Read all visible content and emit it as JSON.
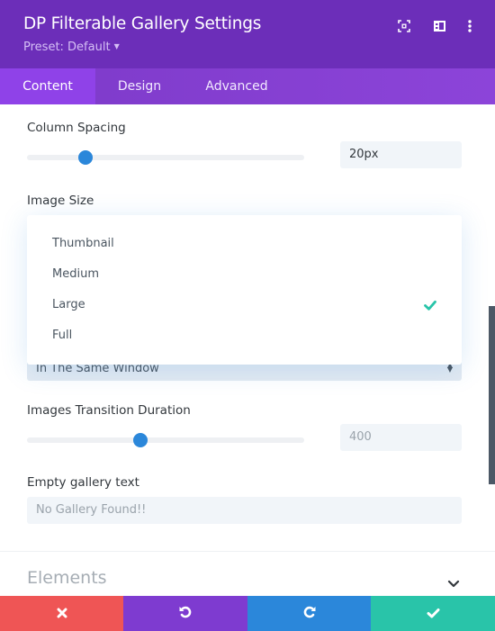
{
  "header": {
    "title": "DP Filterable Gallery Settings",
    "preset_label": "Preset: Default",
    "icons": [
      "expand-icon",
      "split-view-icon",
      "more-options-icon"
    ],
    "background_color": "#6c2eb9"
  },
  "tabs": [
    {
      "label": "Content",
      "active": true
    },
    {
      "label": "Design",
      "active": false
    },
    {
      "label": "Advanced",
      "active": false
    }
  ],
  "fields": {
    "column_spacing": {
      "label": "Column Spacing",
      "value": "20px",
      "slider_fraction": 0.21
    },
    "image_size": {
      "label": "Image Size",
      "options": [
        {
          "label": "Thumbnail",
          "selected": false
        },
        {
          "label": "Medium",
          "selected": false
        },
        {
          "label": "Large",
          "selected": true
        },
        {
          "label": "Full",
          "selected": false
        }
      ],
      "selected_check_color": "#29c4a9"
    },
    "link_target": {
      "value": "In The Same Window"
    },
    "transition_duration": {
      "label": "Images Transition Duration",
      "value": "400",
      "slider_fraction": 0.41
    },
    "empty_gallery_text": {
      "label": "Empty gallery text",
      "placeholder": "No Gallery Found!!"
    }
  },
  "sections": [
    {
      "title": "Elements",
      "collapsed": true
    }
  ],
  "footer": {
    "buttons": [
      {
        "name": "discard",
        "icon": "close-icon",
        "color": "#ef5555"
      },
      {
        "name": "undo",
        "icon": "undo-icon",
        "color": "#7e3bd0"
      },
      {
        "name": "redo",
        "icon": "redo-icon",
        "color": "#2b87da"
      },
      {
        "name": "save",
        "icon": "check-icon",
        "color": "#29c4a9"
      }
    ]
  },
  "accent_color": "#2b87da"
}
